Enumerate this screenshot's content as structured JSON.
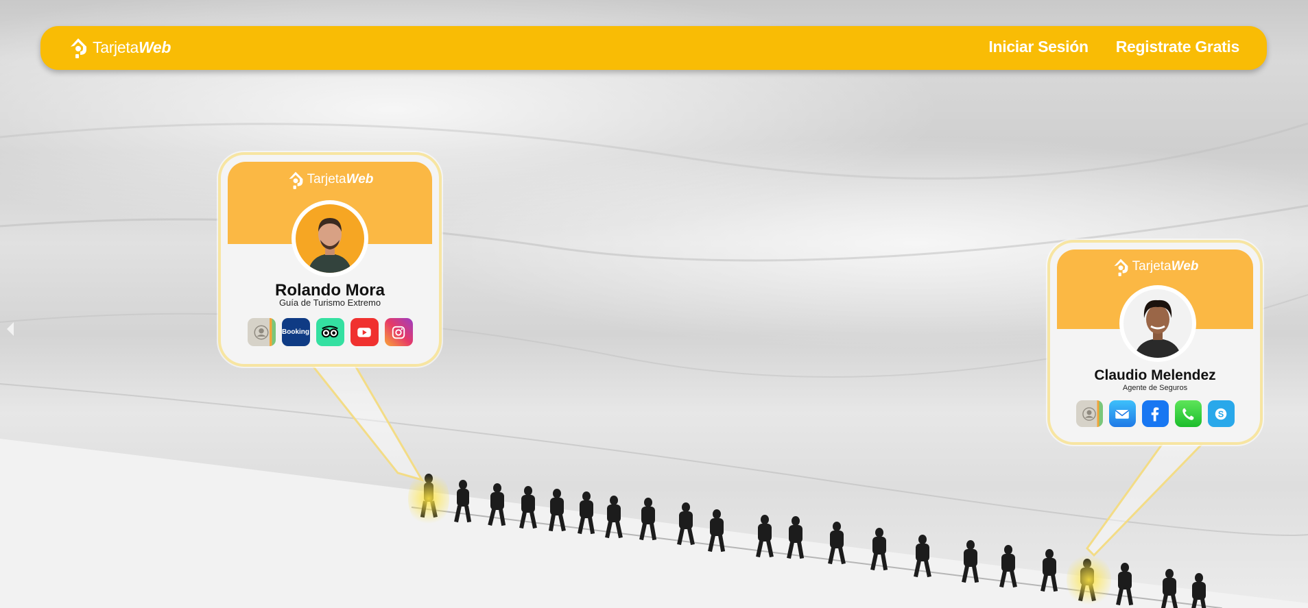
{
  "brand": {
    "name_regular": "Tarjeta",
    "name_bold": "Web"
  },
  "nav": {
    "login": "Iniciar Sesión",
    "register": "Registrate Gratis"
  },
  "cards": [
    {
      "brand_regular": "Tarjeta",
      "brand_bold": "Web",
      "name": "Rolando Mora",
      "role": "Guía de Turismo Extremo",
      "apps": [
        "contacts-icon",
        "booking-icon",
        "tripadvisor-icon",
        "youtube-icon",
        "instagram-icon"
      ],
      "booking_label": "Booking"
    },
    {
      "brand_regular": "Tarjeta",
      "brand_bold": "Web",
      "name": "Claudio Melendez",
      "role": "Agente de Seguros",
      "apps": [
        "contacts-icon",
        "mail-icon",
        "facebook-icon",
        "phone-icon",
        "skype-icon"
      ]
    }
  ],
  "colors": {
    "accent": "#f9bc05",
    "card_header": "#fbb844",
    "highlight": "#ffe646"
  }
}
